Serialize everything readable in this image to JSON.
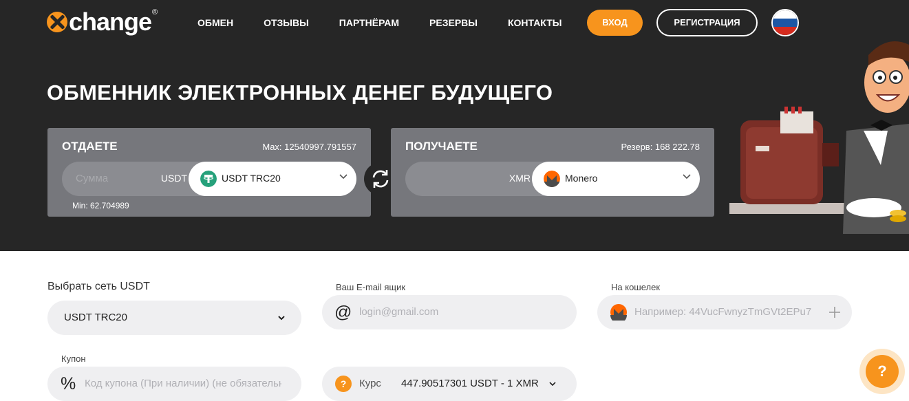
{
  "brand": {
    "name": "change",
    "reg": "®"
  },
  "nav": [
    "ОБМЕН",
    "ОТЗЫВЫ",
    "ПАРТНЁРАМ",
    "РЕЗЕРВЫ",
    "КОНТАКТЫ"
  ],
  "header": {
    "login": "ВХОД",
    "register": "РЕГИСТРАЦИЯ",
    "language_flag": "russia-flag-icon"
  },
  "headline": "ОБМЕННИК ЭЛЕКТРОННЫХ ДЕНЕГ БУДУЩЕГО",
  "give": {
    "title": "ОТДАЕТЕ",
    "max": "Max: 12540997.791557",
    "amount_placeholder": "Сумма",
    "currency": "USDT",
    "select_label": "USDT TRC20",
    "min": "Min: 62.704989"
  },
  "receive": {
    "title": "ПОЛУЧАЕТЕ",
    "reserve": "Резерв: 168 222.78",
    "currency": "XMR",
    "select_label": "Monero"
  },
  "form": {
    "network_label": "Выбрать сеть USDT",
    "network_value": "USDT TRC20",
    "email_label": "Ваш E-mail ящик",
    "email_placeholder": "login@gmail.com",
    "wallet_label": "На кошелек",
    "wallet_placeholder": "Например: 44VucFwnyzTmGVt2EPu7",
    "coupon_label": "Купон",
    "coupon_placeholder": "Код купона (При наличии) (не обязательно)",
    "rate_label": "Курс",
    "rate_value": "447.90517301 USDT - 1 XMR"
  },
  "help": "?",
  "colors": {
    "accent": "#f7941d",
    "dark": "#262626",
    "panel": "#76777c",
    "tether": "#26a17b",
    "monero": "#ff6600"
  }
}
